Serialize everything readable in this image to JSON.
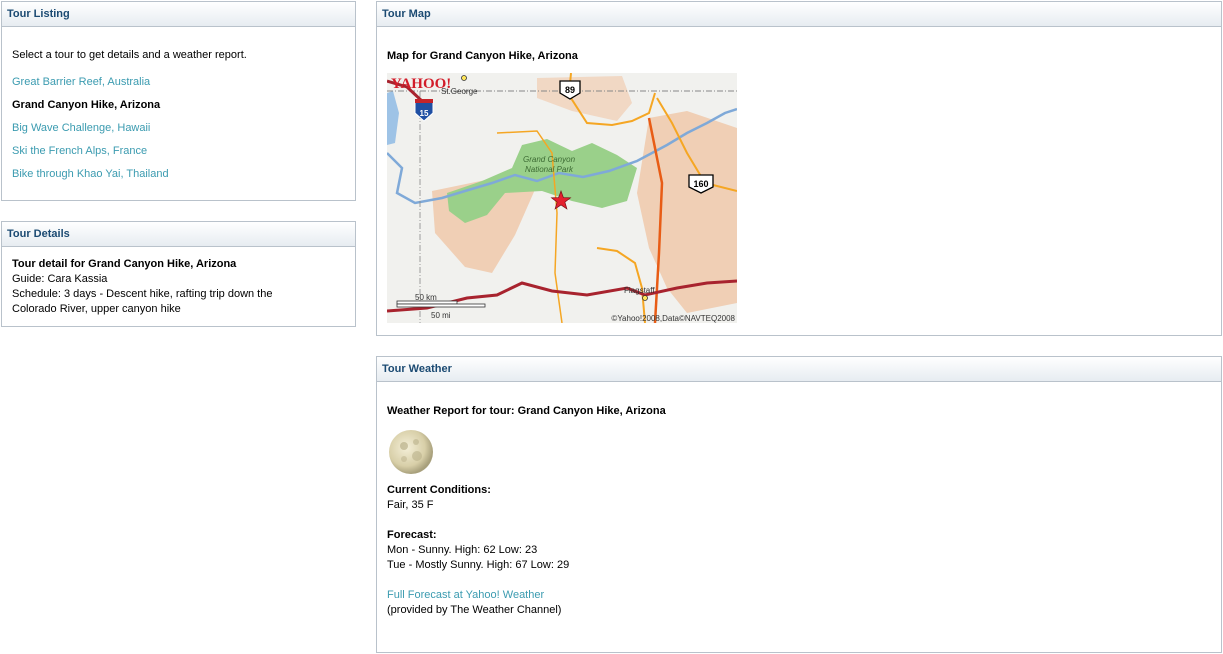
{
  "listing": {
    "title": "Tour Listing",
    "intro": "Select a tour to get details and a weather report.",
    "tours": [
      {
        "label": "Great Barrier Reef, Australia"
      },
      {
        "label": "Grand Canyon Hike, Arizona"
      },
      {
        "label": "Big Wave Challenge, Hawaii"
      },
      {
        "label": "Ski the French Alps, France"
      },
      {
        "label": "Bike through Khao Yai, Thailand"
      }
    ],
    "selected_index": 1
  },
  "details": {
    "title": "Tour Details",
    "heading": "Tour detail for Grand Canyon Hike, Arizona",
    "guide": "Guide: Cara Kassia",
    "schedule_line1": "Schedule: 3 days - Descent hike, rafting trip down the",
    "schedule_line2": "Colorado River, upper canyon hike"
  },
  "map": {
    "title": "Tour Map",
    "heading": "Map for Grand Canyon Hike, Arizona",
    "logo": "YAHOO!",
    "labels": {
      "st_george": "St.George",
      "park_line1": "Grand Canyon",
      "park_line2": "National Park",
      "flagstaff": "Flagstaff",
      "hwy_89": "89",
      "hwy_160": "160",
      "i15": "15",
      "scale_km": "50 km",
      "scale_mi": "50 mi",
      "copyright": "©Yahoo!2008,Data©NAVTEQ2008"
    }
  },
  "weather": {
    "title": "Tour Weather",
    "heading": "Weather Report for tour: Grand Canyon Hike, Arizona",
    "icon": "moon-icon",
    "current_label": "Current Conditions:",
    "current_value": "Fair, 35 F",
    "forecast_label": "Forecast:",
    "forecast": [
      {
        "text": "Mon - Sunny. High: 62 Low: 23"
      },
      {
        "text": "Tue - Mostly Sunny. High: 67 Low: 29"
      }
    ],
    "full_forecast_link": "Full Forecast at Yahoo! Weather",
    "provider": "(provided by The Weather Channel)"
  }
}
